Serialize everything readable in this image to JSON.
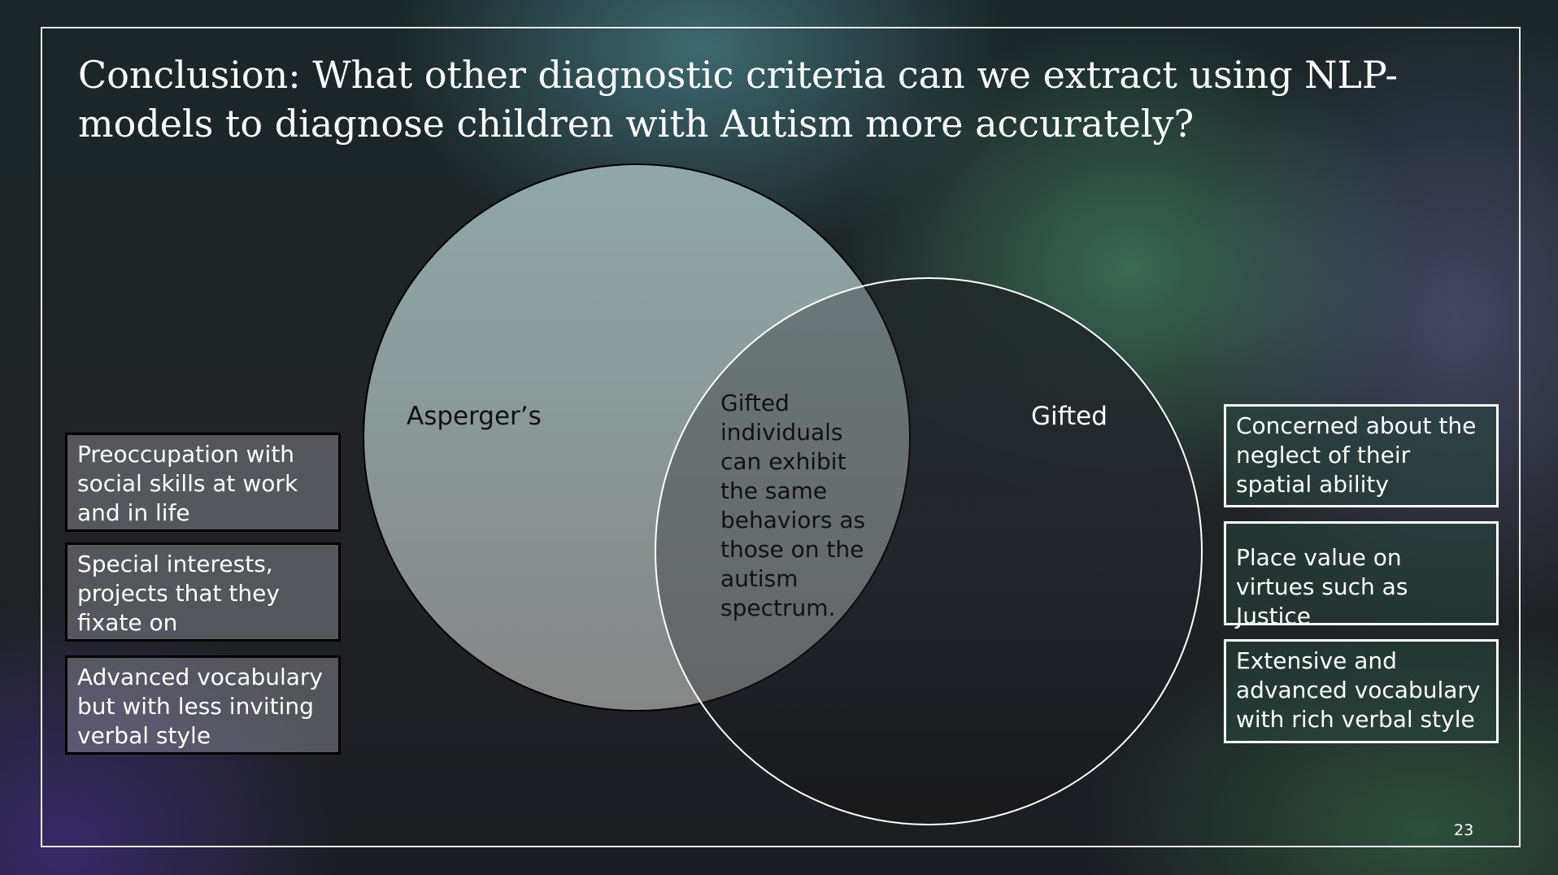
{
  "slide": {
    "title": "Conclusion: What other diagnostic criteria can we extract using NLP-models to diagnose children with Autism more accurately?",
    "page_number": "23"
  },
  "venn": {
    "left_label": "Asperger’s",
    "right_label": "Gifted",
    "overlap_text": "Gifted individuals can exhibit the same behaviors as those on the autism spectrum."
  },
  "left_traits": [
    "Preoccupation with social skills at work and in life",
    "Special interests, projects that they fixate on",
    "Advanced vocabulary but with less inviting verbal style"
  ],
  "right_traits": [
    "Concerned about the neglect of their spatial ability",
    "Place value on virtues such as Justice",
    "Extensive and advanced vocabulary with rich verbal style"
  ],
  "colors": {
    "asperger_fill": "#8fa5a5",
    "gifted_outline": "#ffffff",
    "box_left_border": "#000000",
    "box_right_border": "#ffffff"
  }
}
